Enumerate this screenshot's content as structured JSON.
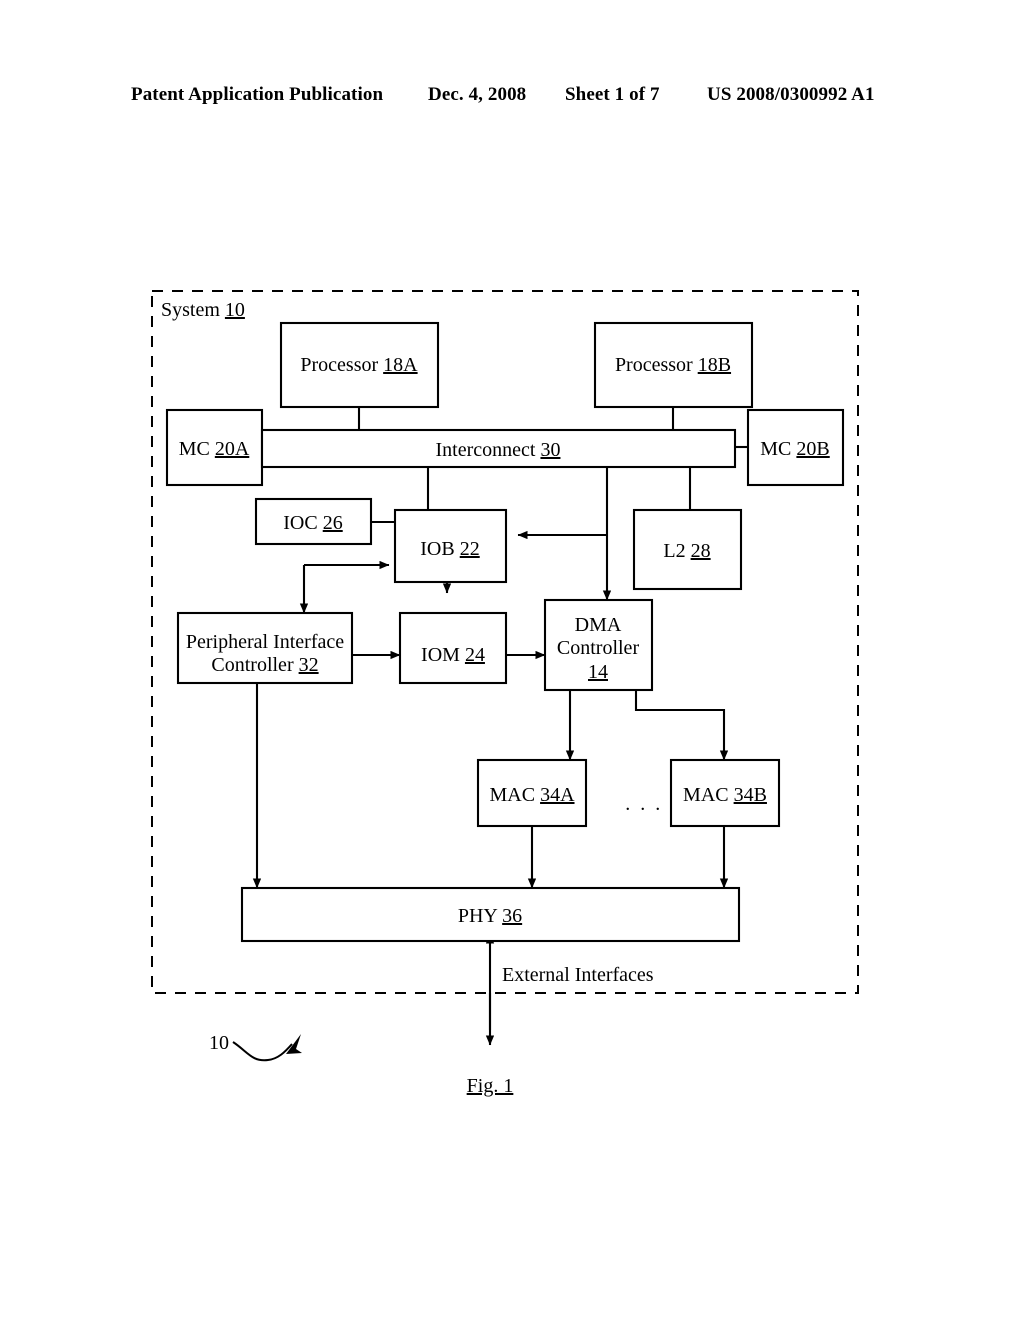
{
  "header": {
    "publication": "Patent Application Publication",
    "date": "Dec. 4, 2008",
    "sheet": "Sheet 1 of 7",
    "patent_number": "US 2008/0300992 A1"
  },
  "figure": {
    "caption": "Fig. 1",
    "callout_number": "10",
    "container_label_text": "System",
    "container_label_ref": "10",
    "external_label": "External Interfaces",
    "ellipsis": ". . ."
  },
  "blocks": {
    "processor_a": {
      "text": "Processor",
      "ref": "18A"
    },
    "processor_b": {
      "text": "Processor",
      "ref": "18B"
    },
    "mc_a": {
      "text": "MC",
      "ref": "20A"
    },
    "mc_b": {
      "text": "MC",
      "ref": "20B"
    },
    "interconnect": {
      "text": "Interconnect",
      "ref": "30"
    },
    "ioc": {
      "text": "IOC",
      "ref": "26"
    },
    "iob": {
      "text": "IOB",
      "ref": "22"
    },
    "l2": {
      "text": "L2",
      "ref": "28"
    },
    "peripheral_interface_controller": {
      "line1": "Peripheral Interface",
      "line2": "Controller",
      "ref": "32"
    },
    "iom": {
      "text": "IOM",
      "ref": "24"
    },
    "dma_controller": {
      "line1": "DMA",
      "line2": "Controller",
      "ref": "14"
    },
    "mac_a": {
      "text": "MAC",
      "ref": "34A"
    },
    "mac_b": {
      "text": "MAC",
      "ref": "34B"
    },
    "phy": {
      "text": "PHY",
      "ref": "36"
    }
  },
  "colors": {
    "ink": "#000000",
    "paper": "#ffffff"
  }
}
